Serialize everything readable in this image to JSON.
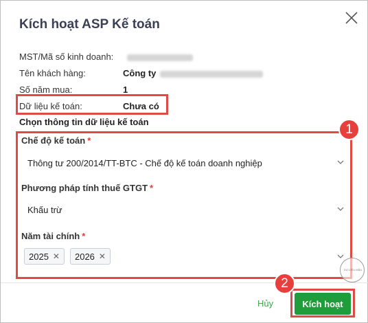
{
  "dialog": {
    "title": "Kích hoạt ASP Kế toán",
    "close_label": "close"
  },
  "info": {
    "tax_code_label": "MST/Mã số kinh doanh:",
    "customer_label": "Tên khách hàng:",
    "customer_value": "Công ty",
    "years_label": "Số năm mua:",
    "years_value": "1",
    "data_label": "Dữ liệu kế toán:",
    "data_value": "Chưa có"
  },
  "section": {
    "title": "Chọn thông tin dữ liệu kế toán"
  },
  "form": {
    "regime_label": "Chế độ kế toán",
    "regime_value": "Thông tư 200/2014/TT-BTC - Chế độ kế toán doanh nghiệp",
    "vat_label": "Phương pháp tính thuế GTGT",
    "vat_value": "Khấu trừ",
    "fiscal_label": "Năm tài chính",
    "required_mark": "*",
    "fiscal_years": [
      "2025",
      "2026"
    ]
  },
  "footer": {
    "cancel_label": "Hủy",
    "activate_label": "Kích hoạt"
  },
  "annotations": {
    "badge_1": "1",
    "badge_2": "2",
    "highlight_color": "#e04a45"
  },
  "watermark": {
    "text": "DỰ LIỆU MẪU"
  },
  "colors": {
    "primary": "#1f9d3a",
    "cancel_text": "#3aa94a",
    "title": "#3a3f55",
    "required": "#e53935"
  }
}
